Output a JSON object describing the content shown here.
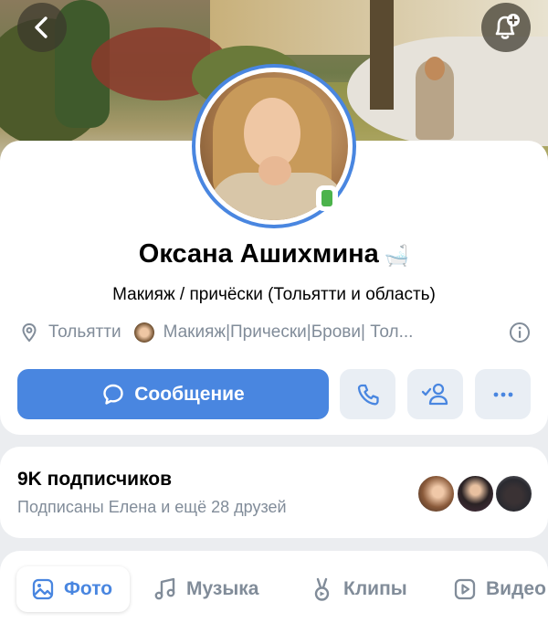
{
  "profile": {
    "name": "Оксана Ашихмина",
    "name_emoji": "🛁",
    "status": "Макияж / причёски (Тольятти и область)",
    "city": "Тольятти",
    "community": "Макияж|Прически|Брови| Тол..."
  },
  "actions": {
    "message_label": "Сообщение"
  },
  "followers": {
    "count_label": "9K подписчиков",
    "friends_label": "Подписаны Елена и ещё 28 друзей"
  },
  "tabs": [
    {
      "label": "Фото",
      "icon": "image-icon",
      "active": true
    },
    {
      "label": "Музыка",
      "icon": "music-note-icon",
      "active": false
    },
    {
      "label": "Клипы",
      "icon": "clips-icon",
      "active": false
    },
    {
      "label": "Видео",
      "icon": "play-icon",
      "active": false
    }
  ],
  "colors": {
    "accent": "#4986e0",
    "secondary_text": "#818c99",
    "online": "#4bb34b"
  }
}
